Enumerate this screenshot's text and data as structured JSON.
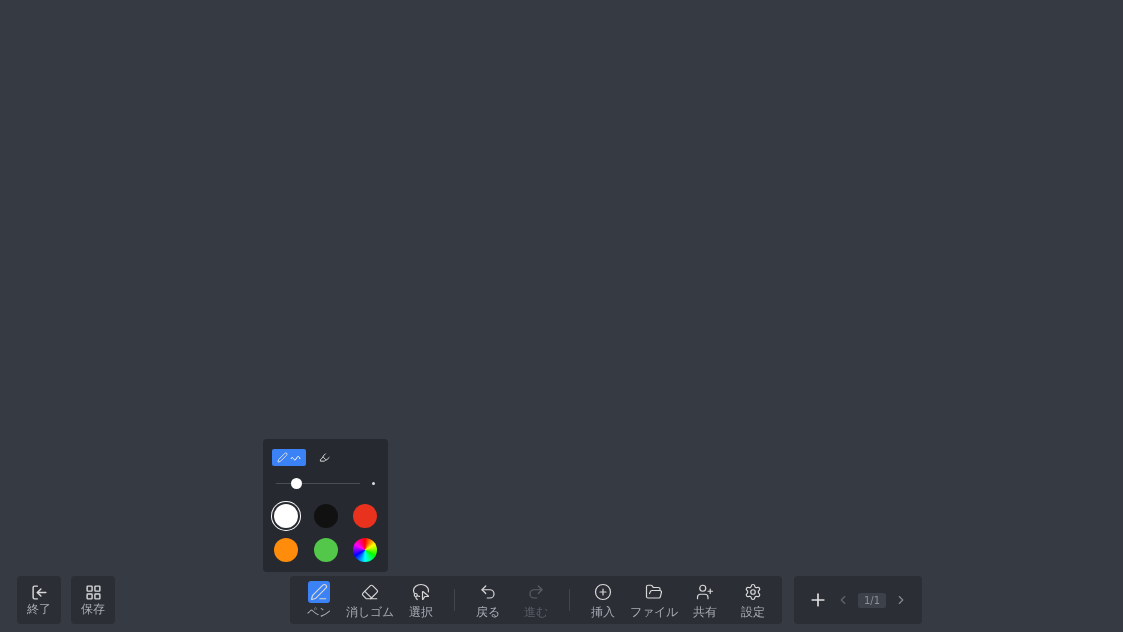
{
  "left_buttons": [
    {
      "kind": "exit",
      "label": "終了"
    },
    {
      "kind": "save",
      "label": "保存"
    }
  ],
  "palette": {
    "modes": [
      {
        "kind": "pen",
        "selected": true
      },
      {
        "kind": "marker",
        "selected": false
      }
    ],
    "thickness": {
      "level": 0.2
    },
    "colors": [
      {
        "color": "#ffffff",
        "selected": true
      },
      {
        "color": "#111111",
        "selected": false
      },
      {
        "color": "#e8321e",
        "selected": false
      },
      {
        "color": "#ff8c0a",
        "selected": false
      },
      {
        "color": "#52c74a",
        "selected": false
      },
      {
        "kind": "rainbow",
        "selected": false
      }
    ]
  },
  "toolbar": [
    {
      "kind": "pen",
      "label": "ペン",
      "selected": true,
      "disabled": false
    },
    {
      "kind": "eraser",
      "label": "消しゴム",
      "selected": false,
      "disabled": false
    },
    {
      "kind": "select",
      "label": "選択",
      "selected": false,
      "disabled": false
    },
    {
      "kind": "divider"
    },
    {
      "kind": "undo",
      "label": "戻る",
      "selected": false,
      "disabled": false
    },
    {
      "kind": "redo",
      "label": "進む",
      "selected": false,
      "disabled": true
    },
    {
      "kind": "divider"
    },
    {
      "kind": "insert",
      "label": "挿入",
      "selected": false,
      "disabled": false
    },
    {
      "kind": "file",
      "label": "ファイル",
      "selected": false,
      "disabled": false
    },
    {
      "kind": "share",
      "label": "共有",
      "selected": false,
      "disabled": false
    },
    {
      "kind": "settings",
      "label": "設定",
      "selected": false,
      "disabled": false
    }
  ],
  "pager": {
    "page": "1/1"
  }
}
